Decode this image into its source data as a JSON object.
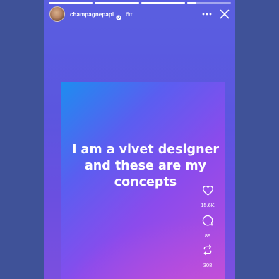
{
  "story": {
    "progress_fractions": [
      1,
      1,
      1,
      0.2
    ],
    "user": {
      "username": "champagnepapi",
      "verified": true,
      "time_ago": "6m"
    },
    "header_icons": [
      "more-icon",
      "close-icon"
    ]
  },
  "post": {
    "lines": [
      "I am a vivet designer",
      "and these are my",
      "concepts"
    ],
    "actions": {
      "likes": "15.6K",
      "comments": "89",
      "reposts": "308"
    }
  },
  "colors": {
    "page_background": "#3f5298",
    "story_background": "#5a5fe0",
    "post_gradient_start": "#1d8df0",
    "post_gradient_end": "#b44edc",
    "text": "#ffffff"
  }
}
